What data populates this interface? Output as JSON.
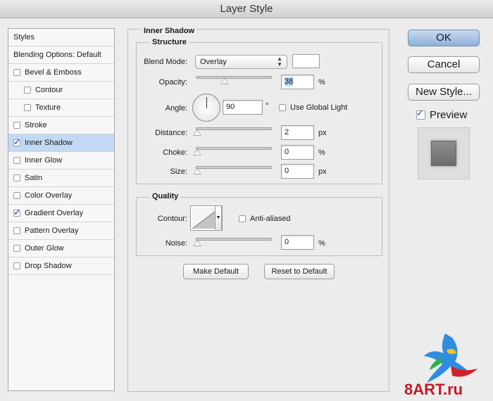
{
  "window": {
    "title": "Layer Style"
  },
  "styles_list": {
    "header": "Styles",
    "blending": "Blending Options: Default",
    "items": [
      {
        "label": "Bevel & Emboss",
        "checked": false,
        "sub": false,
        "selected": false
      },
      {
        "label": "Contour",
        "checked": false,
        "sub": true,
        "selected": false
      },
      {
        "label": "Texture",
        "checked": false,
        "sub": true,
        "selected": false
      },
      {
        "label": "Stroke",
        "checked": false,
        "sub": false,
        "selected": false
      },
      {
        "label": "Inner Shadow",
        "checked": true,
        "sub": false,
        "selected": true
      },
      {
        "label": "Inner Glow",
        "checked": false,
        "sub": false,
        "selected": false
      },
      {
        "label": "Satin",
        "checked": false,
        "sub": false,
        "selected": false
      },
      {
        "label": "Color Overlay",
        "checked": false,
        "sub": false,
        "selected": false
      },
      {
        "label": "Gradient Overlay",
        "checked": true,
        "sub": false,
        "selected": false
      },
      {
        "label": "Pattern Overlay",
        "checked": false,
        "sub": false,
        "selected": false
      },
      {
        "label": "Outer Glow",
        "checked": false,
        "sub": false,
        "selected": false
      },
      {
        "label": "Drop Shadow",
        "checked": false,
        "sub": false,
        "selected": false
      }
    ]
  },
  "panel": {
    "title": "Inner Shadow",
    "structure": {
      "title": "Structure",
      "blend_mode_label": "Blend Mode:",
      "blend_mode_value": "Overlay",
      "opacity_label": "Opacity:",
      "opacity_value": "38",
      "opacity_unit": "%",
      "opacity_fraction": 0.38,
      "angle_label": "Angle:",
      "angle_value": "90",
      "angle_unit": "°",
      "use_global_light": "Use Global Light",
      "distance_label": "Distance:",
      "distance_value": "2",
      "distance_unit": "px",
      "choke_label": "Choke:",
      "choke_value": "0",
      "choke_unit": "%",
      "size_label": "Size:",
      "size_value": "0",
      "size_unit": "px"
    },
    "quality": {
      "title": "Quality",
      "contour_label": "Contour:",
      "anti_aliased": "Anti-aliased",
      "noise_label": "Noise:",
      "noise_value": "0",
      "noise_unit": "%"
    },
    "make_default": "Make Default",
    "reset_default": "Reset to Default"
  },
  "actions": {
    "ok": "OK",
    "cancel": "Cancel",
    "new_style": "New Style...",
    "preview": "Preview",
    "preview_checked": true
  },
  "watermark": {
    "text": "8ART.ru"
  },
  "icons": [
    "checkbox-icon",
    "dial-icon",
    "select-arrows-icon",
    "contour-curve-icon",
    "slider-thumb-icon",
    "parrot-logo-icon"
  ]
}
